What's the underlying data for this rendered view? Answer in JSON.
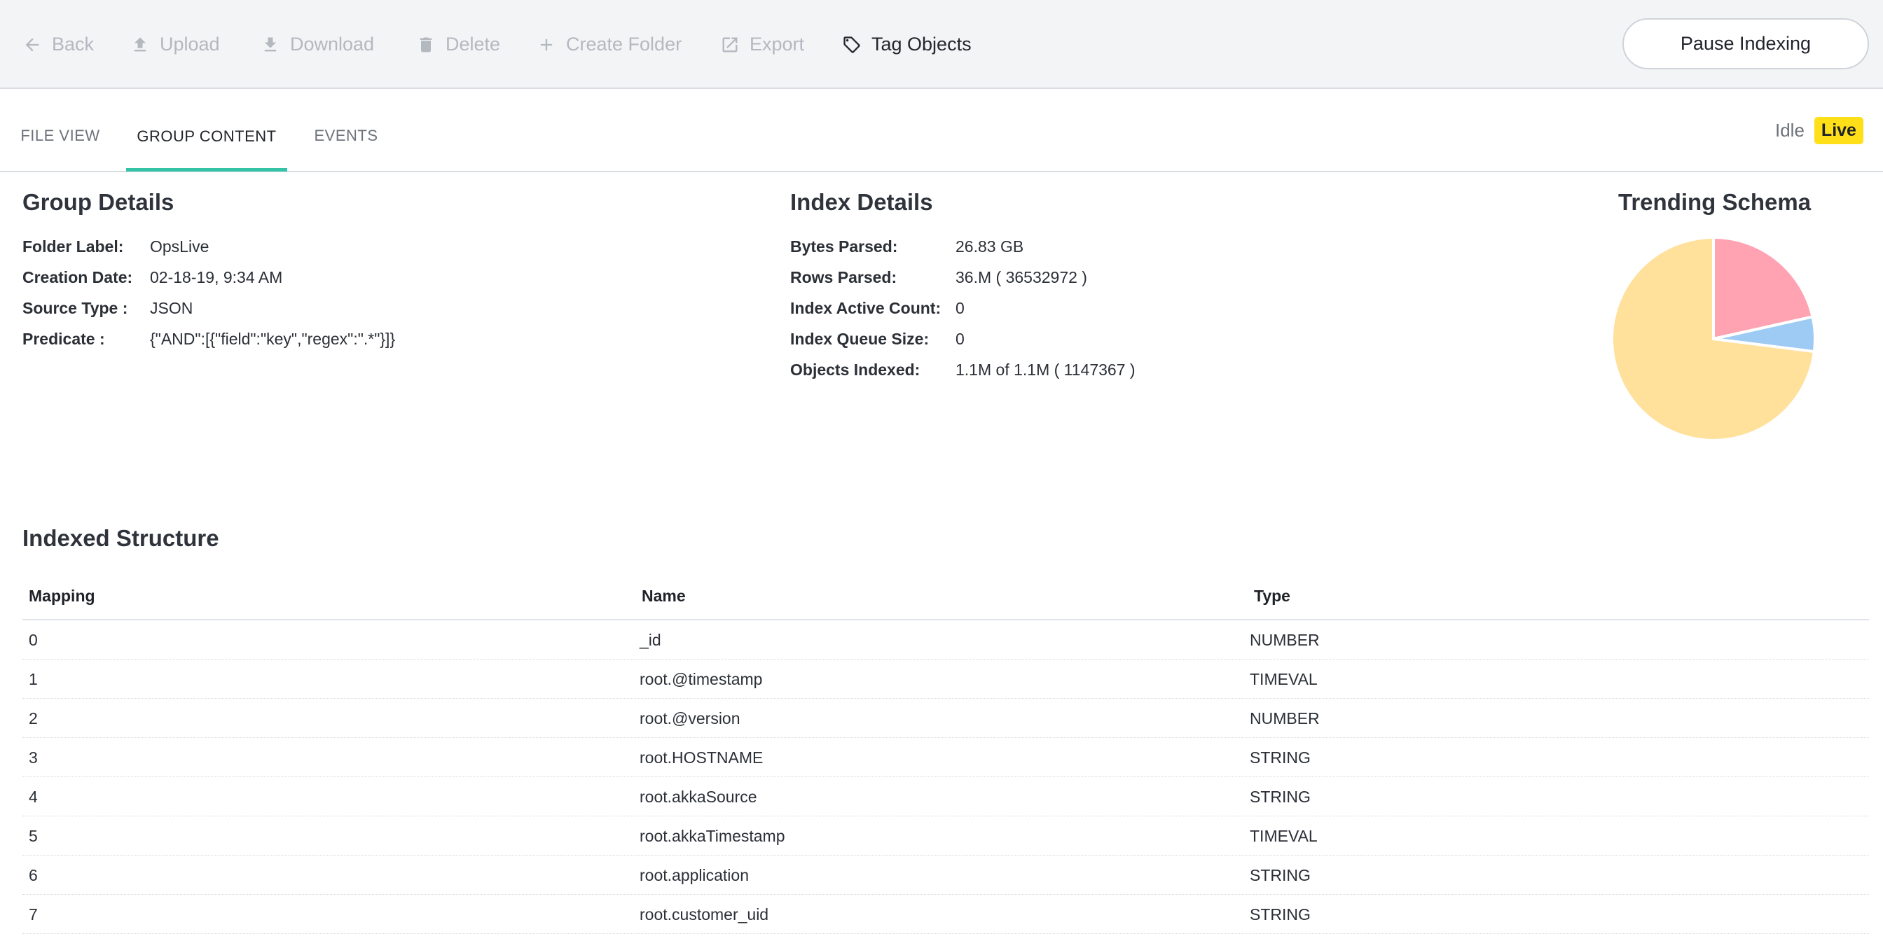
{
  "toolbar": {
    "back_label": "Back",
    "upload_label": "Upload",
    "download_label": "Download",
    "delete_label": "Delete",
    "create_folder_label": "Create Folder",
    "export_label": "Export",
    "tag_objects_label": "Tag Objects",
    "pause_label": "Pause Indexing"
  },
  "tabs": [
    {
      "label": "FILE VIEW",
      "active": false
    },
    {
      "label": "GROUP CONTENT",
      "active": true
    },
    {
      "label": "EVENTS",
      "active": false
    }
  ],
  "status": {
    "text": "Idle",
    "badge": "Live",
    "badge_color": "#ffe018"
  },
  "group_details": {
    "title": "Group Details",
    "fields": [
      {
        "key": "Folder Label:",
        "value": "OpsLive"
      },
      {
        "key": "Creation Date:",
        "value": "02-18-19, 9:34 AM"
      },
      {
        "key": "Source Type :",
        "value": "JSON"
      },
      {
        "key": "Predicate :",
        "value": "{\"AND\":[{\"field\":\"key\",\"regex\":\".*\"}]}"
      }
    ]
  },
  "index_details": {
    "title": "Index Details",
    "fields": [
      {
        "key": "Bytes Parsed:",
        "value": "26.83 GB"
      },
      {
        "key": "Rows Parsed:",
        "value": "36.M ( 36532972 )"
      },
      {
        "key": "Index Active Count:",
        "value": "0"
      },
      {
        "key": "Index Queue Size:",
        "value": "0"
      },
      {
        "key": "Objects Indexed:",
        "value": "1.1M of 1.1M ( 1147367 )"
      }
    ]
  },
  "trending_schema": {
    "title": "Trending Schema",
    "chart_data": {
      "type": "pie",
      "slices": [
        {
          "value": 0.215,
          "color": "#ffa3b3"
        },
        {
          "value": 0.055,
          "color": "#9dcbf3"
        },
        {
          "value": 0.73,
          "color": "#ffe19c"
        }
      ]
    }
  },
  "indexed_structure": {
    "title": "Indexed Structure",
    "columns": [
      "Mapping",
      "Name",
      "Type"
    ],
    "rows": [
      [
        "0",
        "_id",
        "NUMBER"
      ],
      [
        "1",
        "root.@timestamp",
        "TIMEVAL"
      ],
      [
        "2",
        "root.@version",
        "NUMBER"
      ],
      [
        "3",
        "root.HOSTNAME",
        "STRING"
      ],
      [
        "4",
        "root.akkaSource",
        "STRING"
      ],
      [
        "5",
        "root.akkaTimestamp",
        "TIMEVAL"
      ],
      [
        "6",
        "root.application",
        "STRING"
      ],
      [
        "7",
        "root.customer_uid",
        "STRING"
      ]
    ]
  }
}
